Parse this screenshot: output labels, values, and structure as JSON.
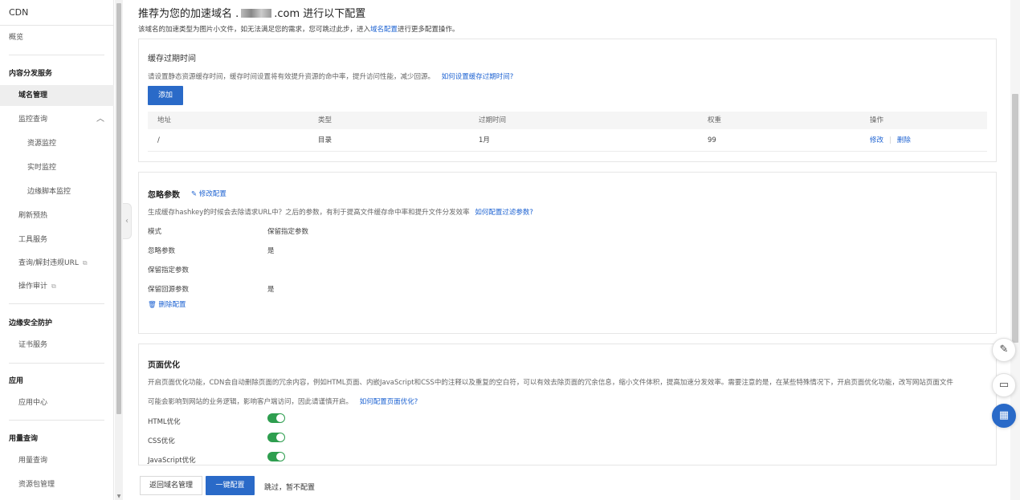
{
  "sidebar": {
    "title": "CDN",
    "overview": "概览",
    "group_content": "内容分发服务",
    "domain_mgmt": "域名管理",
    "monitor_query": "监控查询",
    "resource_monitor": "资源监控",
    "realtime_monitor": "实时监控",
    "edge_script_monitor": "边缘脚本监控",
    "refresh_preload": "刷新预热",
    "tool_service": "工具服务",
    "query_unblock": "查询/解封违规URL",
    "op_audit": "操作审计",
    "group_edge_security": "边缘安全防护",
    "cert_service": "证书服务",
    "group_app": "应用",
    "app_center": "应用中心",
    "group_usage": "用量查询",
    "usage_query": "用量查询",
    "package_mgmt": "资源包管理"
  },
  "header": {
    "title_prefix": "推荐为您的加速域名 .",
    "title_suffix": ".com 进行以下配置",
    "desc_prefix": "该域名的加速类型为图片小文件，如无法满足您的需求，您可跳过此步，进入",
    "desc_link": "域名配置",
    "desc_suffix": "进行更多配置操作。"
  },
  "cache": {
    "title": "缓存过期时间",
    "desc": "请设置静态资源缓存时间，缓存时间设置将有效提升资源的命中率，提升访问性能，减少回源。",
    "help_link": "如何设置缓存过期时间?",
    "add_button": "添加",
    "columns": [
      "地址",
      "类型",
      "过期时间",
      "权重",
      "操作"
    ],
    "rows": [
      {
        "path": "/",
        "type": "目录",
        "ttl": "1月",
        "weight": "99",
        "edit": "修改",
        "delete": "删除"
      }
    ]
  },
  "ignore": {
    "title": "忽略参数",
    "edit_link": "修改配置",
    "desc": "生成缓存hashkey的时候会去除请求URL中？之后的参数，有利于提高文件缓存命中率和提升文件分发效率",
    "help_link": "如何配置过滤参数?",
    "items": [
      {
        "key": "模式",
        "value": "保留指定参数"
      },
      {
        "key": "忽略参数",
        "value": "是"
      },
      {
        "key": "保留指定参数",
        "value": ""
      },
      {
        "key": "保留回源参数",
        "value": "是"
      }
    ],
    "delete_link": "删除配置"
  },
  "optimize": {
    "title": "页面优化",
    "desc1": "开启页面优化功能，CDN会自动删除页面的冗余内容，例如HTML页面、内嵌JavaScript和CSS中的注释以及重复的空白符，可以有效去除页面的冗余信息，缩小文件体积，提高加速分发效率。需要注意的是，在某些特殊情况下，开启页面优化功能，改写网站页面文件",
    "desc2": "可能会影响到网站的业务逻辑，影响客户端访问，因此请谨慎开启。",
    "help_link": "如何配置页面优化?",
    "toggles": [
      {
        "label": "HTML优化",
        "on": true
      },
      {
        "label": "CSS优化",
        "on": true
      },
      {
        "label": "JavaScript优化",
        "on": true
      }
    ]
  },
  "footer": {
    "back_button": "返回域名管理",
    "apply_button": "一键配置",
    "skip_text": "跳过，暂不配置"
  }
}
